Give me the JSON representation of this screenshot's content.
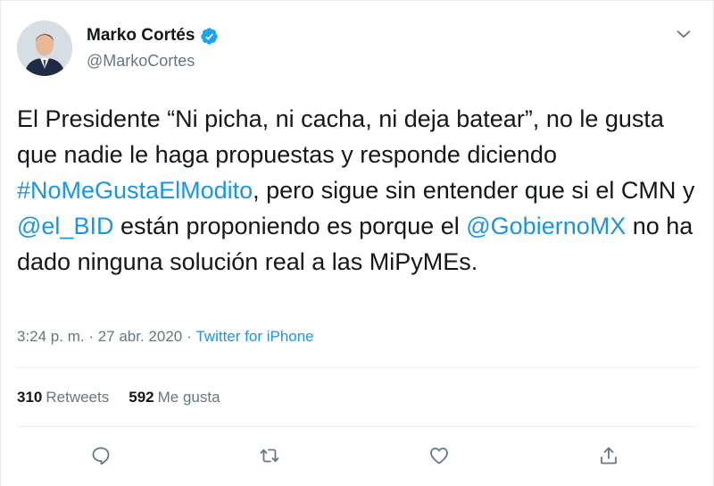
{
  "author": {
    "display_name": "Marko Cortés",
    "handle": "@MarkoCortes",
    "verified": true
  },
  "tweet": {
    "segments": [
      {
        "text": "El Presidente “Ni picha, ni cacha, ni deja batear”, no le gusta que nadie le haga propuestas y responde diciendo ",
        "link": false
      },
      {
        "text": "#NoMeGustaElModito",
        "link": true
      },
      {
        "text": ", pero sigue sin entender que si el CMN y ",
        "link": false
      },
      {
        "text": "@el_BID",
        "link": true
      },
      {
        "text": " están proponiendo es porque el ",
        "link": false
      },
      {
        "text": "@GobiernoMX",
        "link": true
      },
      {
        "text": " no ha dado ninguna solución real a las MiPyMEs.",
        "link": false
      }
    ]
  },
  "meta": {
    "time": "3:24 p. m.",
    "separator": " · ",
    "date": "27 abr. 2020",
    "source": "Twitter for iPhone"
  },
  "stats": {
    "retweets_count": "310",
    "retweets_label": "Retweets",
    "likes_count": "592",
    "likes_label": "Me gusta"
  },
  "actions": {
    "icons": [
      "reply-icon",
      "retweet-icon",
      "like-icon",
      "share-icon"
    ]
  },
  "colors": {
    "link": "#1b95e0",
    "secondary_text": "#657786",
    "primary_text": "#14171a",
    "verified": "#1da1f2",
    "divider": "#e6ecf0"
  }
}
